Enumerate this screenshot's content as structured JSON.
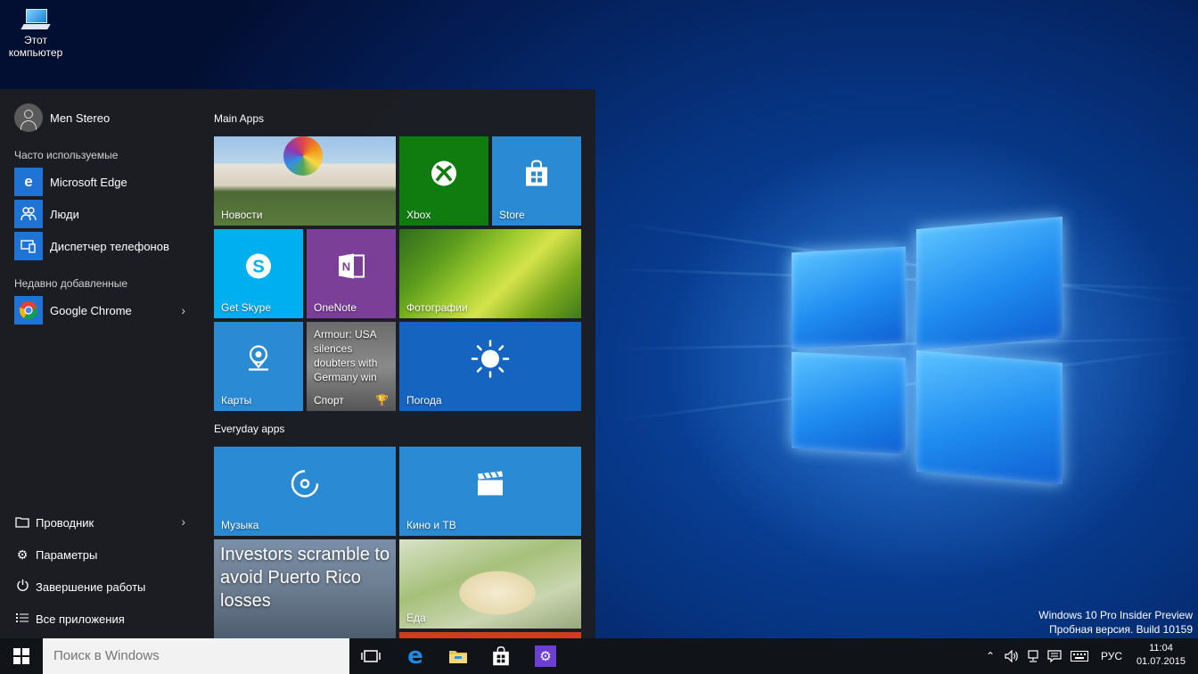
{
  "desktop": {
    "icon_label_line1": "Этот",
    "icon_label_line2": "компьютер",
    "watermark_line1": "Windows 10 Pro Insider Preview",
    "watermark_line2": "Пробная версия. Build 10159"
  },
  "start_menu": {
    "user_name": "Men Stereo",
    "most_used_label": "Часто используемые",
    "most_used": [
      {
        "label": "Microsoft Edge",
        "icon": "edge-icon"
      },
      {
        "label": "Люди",
        "icon": "people-icon"
      },
      {
        "label": "Диспетчер телефонов",
        "icon": "phone-companion-icon"
      }
    ],
    "recent_label": "Недавно добавленные",
    "recent": [
      {
        "label": "Google Chrome",
        "icon": "chrome-icon"
      }
    ],
    "system": [
      {
        "label": "Проводник",
        "icon": "explorer-icon"
      },
      {
        "label": "Параметры",
        "icon": "gear-icon"
      },
      {
        "label": "Завершение работы",
        "icon": "power-icon"
      },
      {
        "label": "Все приложения",
        "icon": "list-icon"
      }
    ],
    "groups": {
      "main": "Main Apps",
      "everyday": "Everyday apps"
    },
    "tiles": {
      "news": "Новости",
      "xbox": "Xbox",
      "store": "Store",
      "skype": "Get Skype",
      "onenote": "OneNote",
      "photos": "Фотографии",
      "maps": "Карты",
      "sport": "Спорт",
      "sport_headline": "Armour: USA silences doubters with Germany win",
      "weather": "Погода",
      "music": "Музыка",
      "movies": "Кино и ТВ",
      "money_headline": "Investors scramble to avoid Puerto Rico losses",
      "food": "Еда"
    }
  },
  "taskbar": {
    "search_placeholder": "Поиск в Windows",
    "language": "РУС",
    "time": "11:04",
    "date": "01.07.2015"
  },
  "colors": {
    "accent": "#1e73d4",
    "xbox": "#107c10",
    "store": "#2a8ad4",
    "skype": "#00aff0",
    "onenote": "#7b3f98",
    "weather": "#1565c0"
  }
}
